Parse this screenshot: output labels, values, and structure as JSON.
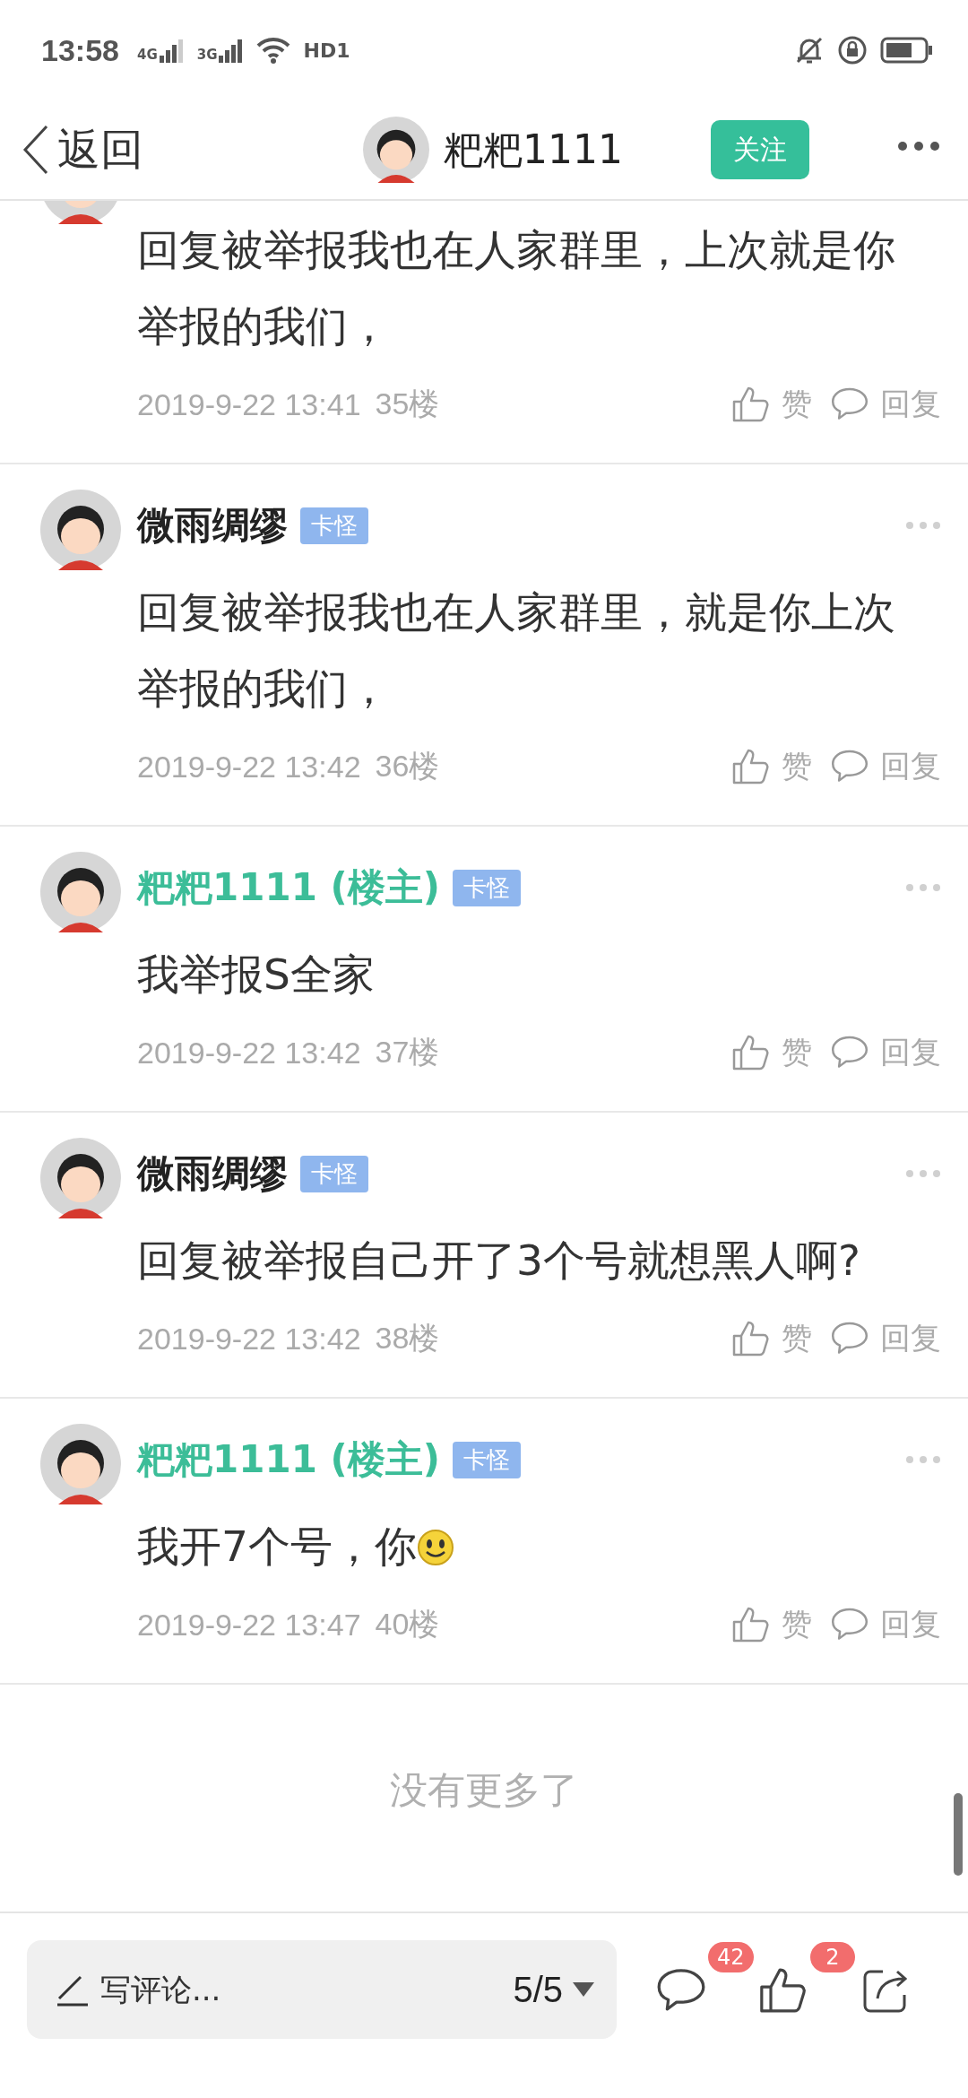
{
  "status_bar": {
    "time": "13:58",
    "networks": [
      "4G",
      "3G"
    ],
    "hd": "HD1"
  },
  "header": {
    "back": "返回",
    "title": "粑粑1111",
    "follow": "关注"
  },
  "posts": [
    {
      "kind": "cut",
      "text": "回复被举报我也在人家群里，上次就是你举报的我们，",
      "time": "2019-9-22 13:41",
      "floor": "35楼",
      "like": "赞",
      "reply": "回复"
    },
    {
      "kind": "full",
      "name": "微雨绸缪",
      "op": false,
      "badge": "卡怪",
      "text": "回复被举报我也在人家群里，就是你上次举报的我们，",
      "time": "2019-9-22 13:42",
      "floor": "36楼",
      "like": "赞",
      "reply": "回复"
    },
    {
      "kind": "full",
      "name": "粑粑1111 (楼主)",
      "op": true,
      "badge": "卡怪",
      "text": "我举报S全家",
      "time": "2019-9-22 13:42",
      "floor": "37楼",
      "like": "赞",
      "reply": "回复"
    },
    {
      "kind": "full",
      "name": "微雨绸缪",
      "op": false,
      "badge": "卡怪",
      "text": "回复被举报自己开了3个号就想黑人啊?",
      "time": "2019-9-22 13:42",
      "floor": "38楼",
      "like": "赞",
      "reply": "回复"
    },
    {
      "kind": "full",
      "name": "粑粑1111 (楼主)",
      "op": true,
      "badge": "卡怪",
      "text": "我开7个号，你",
      "emoji": true,
      "time": "2019-9-22 13:47",
      "floor": "40楼",
      "like": "赞",
      "reply": "回复"
    }
  ],
  "end_note": "没有更多了",
  "bottom_bar": {
    "placeholder": "写评论...",
    "page": "5/5",
    "comment_count": "42",
    "like_count": "2"
  }
}
